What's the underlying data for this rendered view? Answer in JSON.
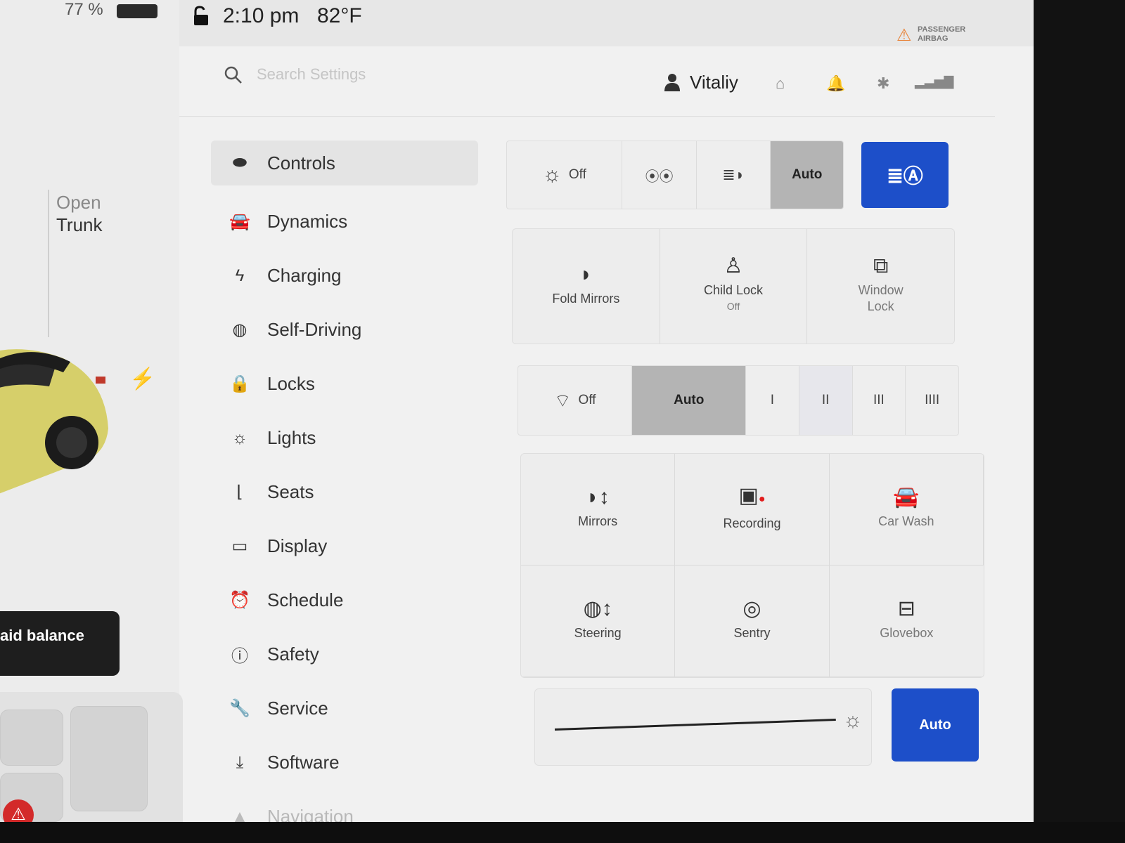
{
  "status": {
    "battery_percent": "77 %",
    "time": "2:10 pm",
    "temperature": "82°F",
    "passenger_airbag_line1": "PASSENGER",
    "passenger_airbag_line2": "AIRBAG"
  },
  "car": {
    "open_label": "Open",
    "trunk_label": "Trunk",
    "balance_text": "aid balance"
  },
  "header": {
    "search_placeholder": "Search Settings",
    "user_name": "Vitaliy"
  },
  "nav": {
    "items": [
      {
        "label": "Controls",
        "icon": "toggle-icon"
      },
      {
        "label": "Dynamics",
        "icon": "car-icon"
      },
      {
        "label": "Charging",
        "icon": "bolt-icon"
      },
      {
        "label": "Self-Driving",
        "icon": "steering-wheel-icon"
      },
      {
        "label": "Locks",
        "icon": "lock-icon"
      },
      {
        "label": "Lights",
        "icon": "sun-icon"
      },
      {
        "label": "Seats",
        "icon": "seat-icon"
      },
      {
        "label": "Display",
        "icon": "display-icon"
      },
      {
        "label": "Schedule",
        "icon": "alarm-clock-icon"
      },
      {
        "label": "Safety",
        "icon": "info-circle-icon"
      },
      {
        "label": "Service",
        "icon": "wrench-icon"
      },
      {
        "label": "Software",
        "icon": "download-icon"
      },
      {
        "label": "Navigation",
        "icon": "navigation-arrow-icon"
      }
    ],
    "active": "Controls"
  },
  "lights": {
    "off_label": "Off",
    "auto_label": "Auto",
    "selected": "Auto"
  },
  "lock_tiles": {
    "fold_mirrors": "Fold Mirrors",
    "child_lock": "Child Lock",
    "child_lock_state": "Off",
    "window_lock_line1": "Window",
    "window_lock_line2": "Lock"
  },
  "wipers": {
    "off_label": "Off",
    "auto_label": "Auto",
    "speeds": [
      "I",
      "II",
      "III",
      "IIII"
    ],
    "selected": "Auto"
  },
  "tiles": {
    "mirrors": "Mirrors",
    "recording": "Recording",
    "car_wash": "Car Wash",
    "steering": "Steering",
    "sentry": "Sentry",
    "glovebox": "Glovebox"
  },
  "brightness": {
    "auto_label": "Auto"
  },
  "colors": {
    "accent_blue": "#1d4fc9",
    "recording_dot": "#e21d1d",
    "airbag_orange": "#e8843a"
  }
}
